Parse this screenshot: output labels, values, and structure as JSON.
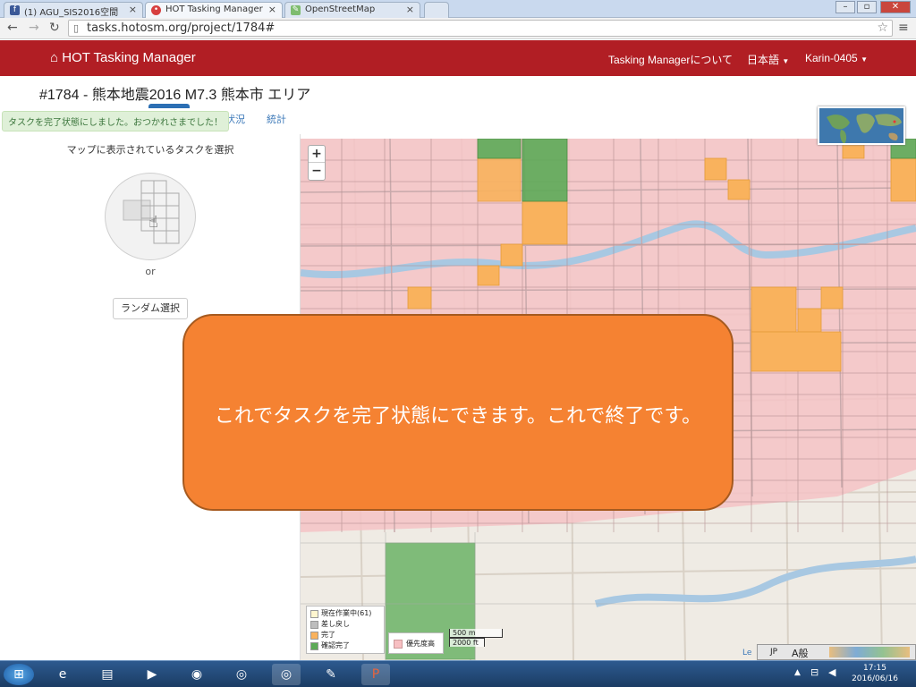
{
  "browser": {
    "tabs": [
      {
        "label": "(1) AGU_SIS2016空間",
        "icon": "facebook-icon",
        "color": "#3b5998"
      },
      {
        "label": "HOT Tasking Manager",
        "icon": "hot-icon",
        "color": "#d73f3f"
      },
      {
        "label": "OpenStreetMap",
        "icon": "osm-icon",
        "color": "#7ebc6f"
      }
    ],
    "url": "tasks.hotosm.org/project/1784#"
  },
  "site": {
    "brand": "HOT Tasking Manager",
    "nav": {
      "about": "Tasking Managerについて",
      "language": "日本語",
      "user": "Karin-0405"
    }
  },
  "project": {
    "title": "#1784 - 熊本地震2016 M7.3 熊本市 エリア",
    "toast": "タスクを完了状態にしました。おつかれさまでした！",
    "tabs": [
      "状況",
      "統計"
    ]
  },
  "panel": {
    "heading": "マップに表示されているタスクを選択",
    "or": "or",
    "random_button": "ランダム選択"
  },
  "map": {
    "zoom_in": "+",
    "zoom_out": "−",
    "legend": [
      {
        "label": "現在作業中(61)",
        "color": "#fff6cf"
      },
      {
        "label": "差し戻し",
        "color": "#bdbdbd"
      },
      {
        "label": "完了",
        "color": "#f9b25d"
      },
      {
        "label": "確認完了",
        "color": "#5daa57"
      }
    ],
    "legend_priority": {
      "label": "優先度高",
      "color": "#f7bfc2"
    },
    "scale": [
      "500 m",
      "2000 ft"
    ],
    "attribution": "Le"
  },
  "overlay": {
    "text": "これでタスクを完了状態にできます。これで終了です。",
    "color": "#f58232"
  },
  "taskbar": {
    "time": "17:15",
    "date": "2016/06/16",
    "ime": "JP"
  }
}
